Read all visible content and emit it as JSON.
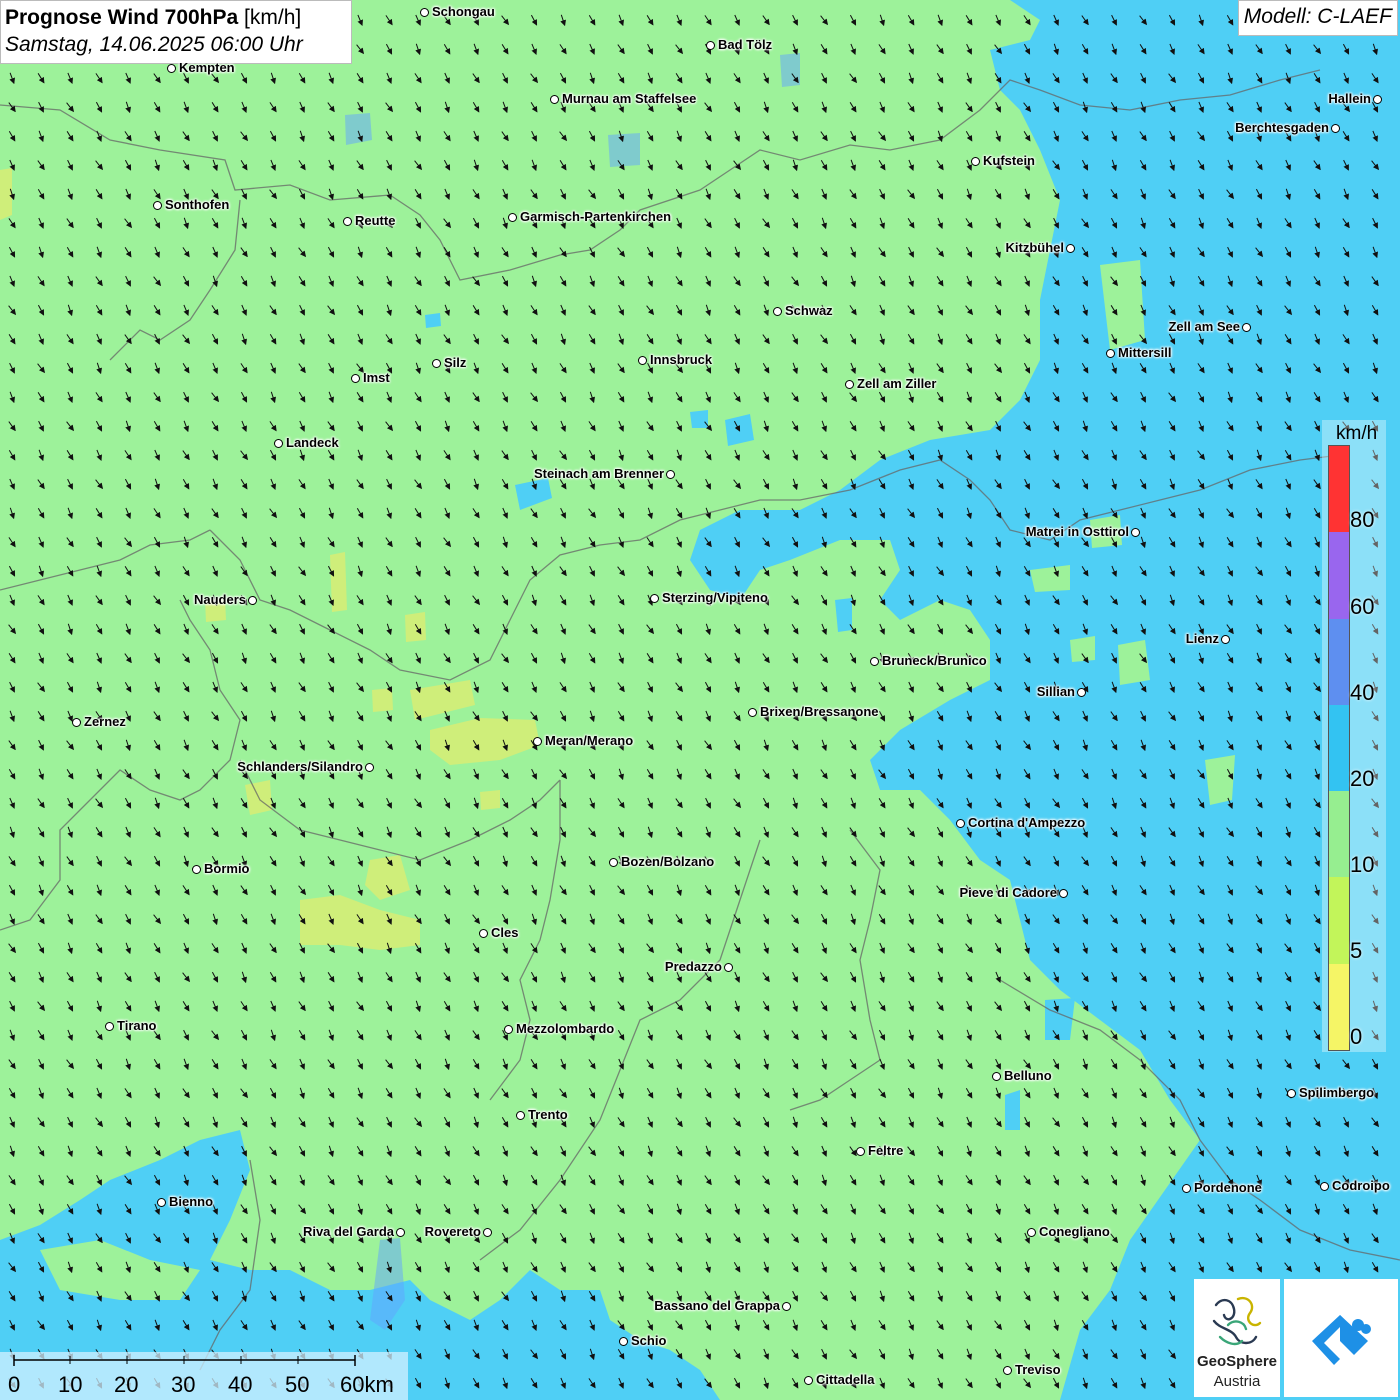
{
  "title": {
    "bold": "Prognose Wind 700hPa",
    "unit": " [km/h]",
    "date": "Samstag, 14.06.2025 06:00 Uhr"
  },
  "model": "Modell: C-LAEF",
  "legend": {
    "unit": "km/h",
    "labels": [
      "80",
      "60",
      "40",
      "20",
      "10",
      "5",
      "0"
    ],
    "colors": [
      "#ff3333",
      "#9966ee",
      "#5e8ff0",
      "#33c3f2",
      "#96ee90",
      "#c2f55a",
      "#f5f566"
    ]
  },
  "scalebar": {
    "labels": [
      "0",
      "10",
      "20",
      "30",
      "40",
      "50",
      "60km"
    ]
  },
  "logos": {
    "name": "GeoSphere",
    "sub": "Austria"
  },
  "field_colors": {
    "green": "#9df29a",
    "blue": "#4fcff5",
    "yellow": "#cfee7a"
  },
  "wind": {
    "prevailing_direction": "NW",
    "arrow_icon": "wind-arrow-icon"
  },
  "cities": [
    {
      "name": "Schongau",
      "side": "r"
    },
    {
      "name": "Bad Tölz",
      "side": "r"
    },
    {
      "name": "Kempten",
      "side": "r"
    },
    {
      "name": "Murnau am Staffelsee",
      "side": "r"
    },
    {
      "name": "Hallein",
      "side": "l"
    },
    {
      "name": "Berchtesgaden",
      "side": "l"
    },
    {
      "name": "Kufstein",
      "side": "r"
    },
    {
      "name": "Sonthofen",
      "side": "r"
    },
    {
      "name": "Reutte",
      "side": "r"
    },
    {
      "name": "Garmisch-Partenkirchen",
      "side": "r"
    },
    {
      "name": "Kitzbühel",
      "side": "l"
    },
    {
      "name": "Schwaz",
      "side": "r"
    },
    {
      "name": "Zell am See",
      "side": "l"
    },
    {
      "name": "Mittersill",
      "side": "r"
    },
    {
      "name": "Innsbruck",
      "side": "r"
    },
    {
      "name": "Silz",
      "side": "r"
    },
    {
      "name": "Imst",
      "side": "r"
    },
    {
      "name": "Zell am Ziller",
      "side": "r"
    },
    {
      "name": "Landeck",
      "side": "r"
    },
    {
      "name": "Steinach am Brenner",
      "side": "l"
    },
    {
      "name": "Matrei in Osttirol",
      "side": "l"
    },
    {
      "name": "Nauders",
      "side": "l"
    },
    {
      "name": "Sterzing/Vipiteno",
      "side": "r"
    },
    {
      "name": "Lienz",
      "side": "l"
    },
    {
      "name": "Bruneck/Brunico",
      "side": "r"
    },
    {
      "name": "Sillian",
      "side": "l"
    },
    {
      "name": "Zernez",
      "side": "r"
    },
    {
      "name": "Brixen/Bressanone",
      "side": "r"
    },
    {
      "name": "Meran/Merano",
      "side": "r"
    },
    {
      "name": "Schlanders/Silandro",
      "side": "l"
    },
    {
      "name": "Cortina d'Ampezzo",
      "side": "r"
    },
    {
      "name": "Bozen/Bolzano",
      "side": "r"
    },
    {
      "name": "Bormio",
      "side": "r"
    },
    {
      "name": "Pieve di Cadore",
      "side": "l"
    },
    {
      "name": "Cles",
      "side": "r"
    },
    {
      "name": "Predazzo",
      "side": "l"
    },
    {
      "name": "Tirano",
      "side": "r"
    },
    {
      "name": "Mezzolombardo",
      "side": "r"
    },
    {
      "name": "Belluno",
      "side": "r"
    },
    {
      "name": "Spilimbergo",
      "side": "r"
    },
    {
      "name": "Trento",
      "side": "r"
    },
    {
      "name": "Feltre",
      "side": "r"
    },
    {
      "name": "Pordenone",
      "side": "r"
    },
    {
      "name": "Codroipo",
      "side": "r"
    },
    {
      "name": "Bienno",
      "side": "r"
    },
    {
      "name": "Riva del Garda",
      "side": "l"
    },
    {
      "name": "Rovereto",
      "side": "l"
    },
    {
      "name": "Conegliano",
      "side": "r"
    },
    {
      "name": "Bassano del Grappa",
      "side": "l"
    },
    {
      "name": "Schio",
      "side": "r"
    },
    {
      "name": "Treviso",
      "side": "r"
    },
    {
      "name": "Cittadella",
      "side": "r"
    }
  ]
}
